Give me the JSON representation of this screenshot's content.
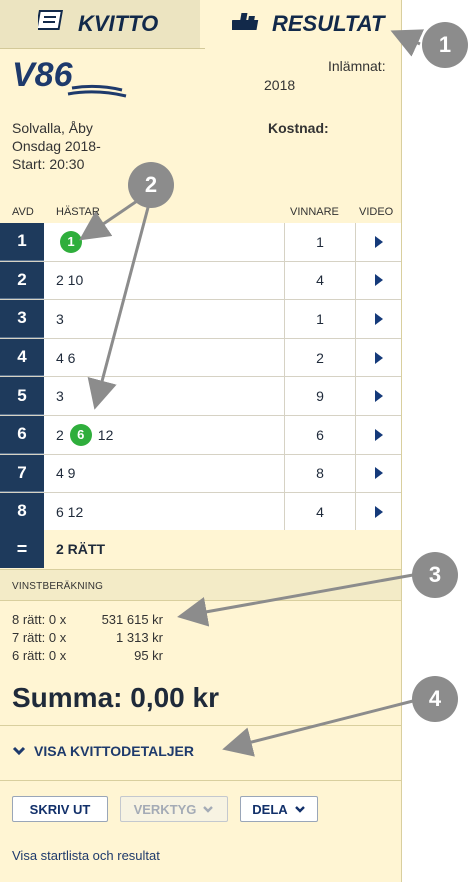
{
  "tabs": {
    "kvitto": "KVITTO",
    "resultat": "RESULTAT"
  },
  "header": {
    "logo": "V86",
    "inlamnat_label": "Inlämnat:",
    "inlamnat_value": "2018",
    "track": "Solvalla, Åby",
    "date": "Onsdag 2018-",
    "start": "Start: 20:30",
    "kostnad_label": "Kostnad:"
  },
  "columns": {
    "avd": "AVD",
    "hastar": "HÄSTAR",
    "vinnare": "VINNARE",
    "video": "VIDEO"
  },
  "rows": [
    {
      "avd": "1",
      "horses_pre": "",
      "highlight": "1",
      "horses_post": "",
      "winner": "1"
    },
    {
      "avd": "2",
      "horses_pre": "2 10",
      "highlight": "",
      "horses_post": "",
      "winner": "4"
    },
    {
      "avd": "3",
      "horses_pre": "3",
      "highlight": "",
      "horses_post": "",
      "winner": "1"
    },
    {
      "avd": "4",
      "horses_pre": "4 6",
      "highlight": "",
      "horses_post": "",
      "winner": "2"
    },
    {
      "avd": "5",
      "horses_pre": "3",
      "highlight": "",
      "horses_post": "",
      "winner": "9"
    },
    {
      "avd": "6",
      "horses_pre": "2",
      "highlight": "6",
      "horses_post": "12",
      "winner": "6"
    },
    {
      "avd": "7",
      "horses_pre": "4 9",
      "highlight": "",
      "horses_post": "",
      "winner": "8"
    },
    {
      "avd": "8",
      "horses_pre": "6 12",
      "highlight": "",
      "horses_post": "",
      "winner": "4"
    }
  ],
  "summary": {
    "symbol": "=",
    "text": "2 RÄTT"
  },
  "vinst": {
    "heading": "VINSTBERÄKNING",
    "lines": [
      {
        "label": "8 rätt: 0 x",
        "amount": "531 615 kr"
      },
      {
        "label": "7 rätt: 0 x",
        "amount": "1 313 kr"
      },
      {
        "label": "6 rätt: 0 x",
        "amount": "95 kr"
      }
    ],
    "summa": "Summa: 0,00 kr"
  },
  "details_link": "VISA KVITTODETALJER",
  "buttons": {
    "skriv_ut": "SKRIV UT",
    "verktyg": "VERKTYG",
    "dela": "DELA"
  },
  "footer_link": "Visa startlista och resultat",
  "callouts": [
    "1",
    "2",
    "3",
    "4"
  ],
  "colors": {
    "navy": "#1e3a5c",
    "panel_bg": "#fff5d3",
    "highlight_green": "#2fae3c",
    "callout_gray": "#8c8c8c"
  },
  "icons": [
    "receipt-icon",
    "results-icon",
    "play-icon",
    "chevron-down-icon"
  ]
}
